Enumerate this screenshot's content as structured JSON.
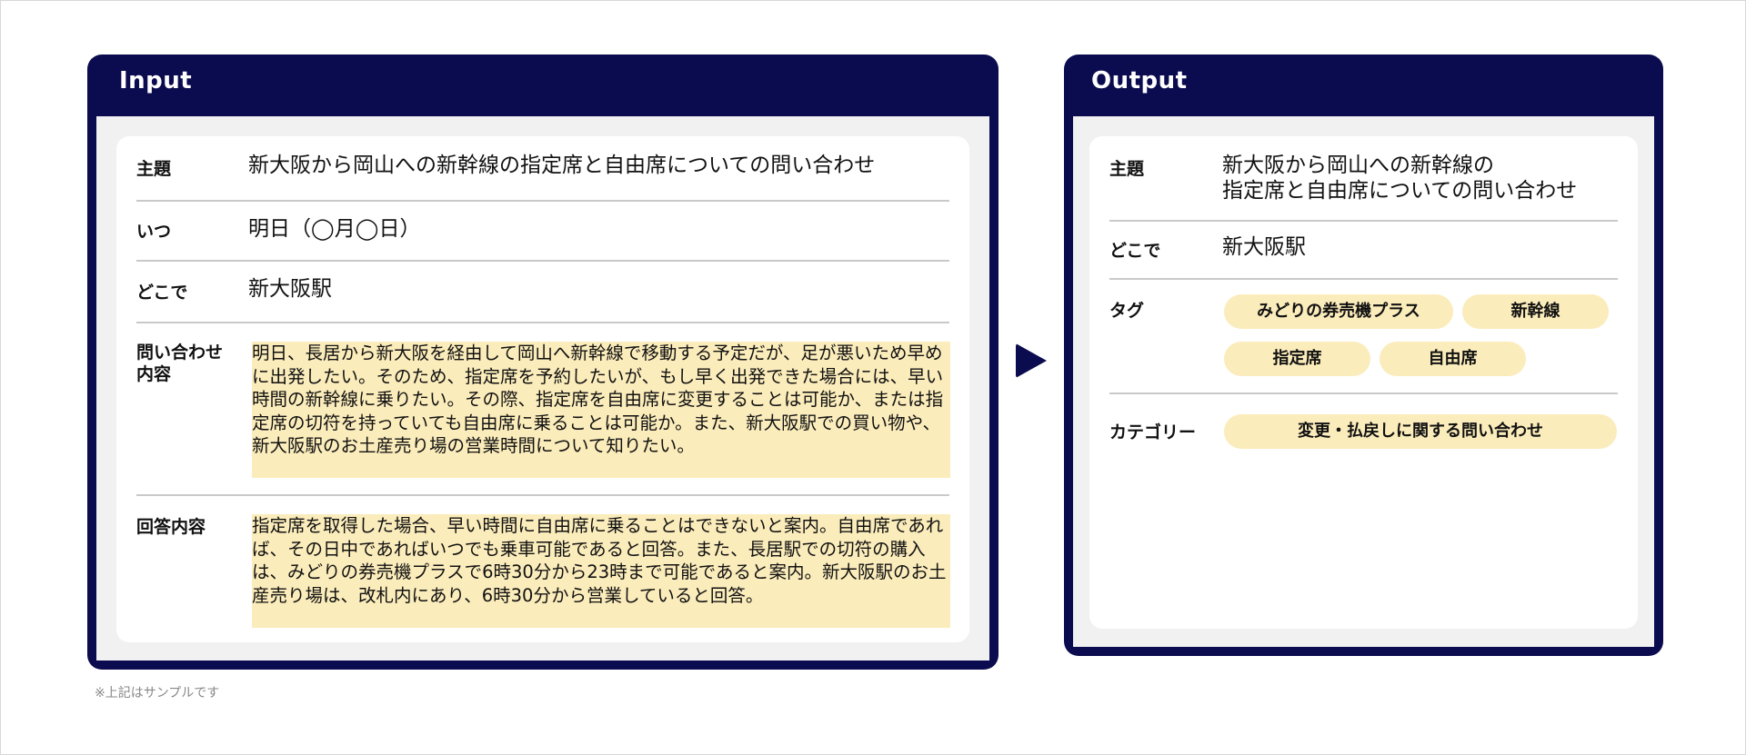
{
  "input_panel": {
    "title": "Input",
    "rows": {
      "subject": {
        "label": "主題",
        "value": "新大阪から岡山への新幹線の指定席と自由席についての問い合わせ"
      },
      "when": {
        "label": "いつ",
        "value": "明日（◯月◯日）"
      },
      "where": {
        "label": "どこで",
        "value": "新大阪駅"
      },
      "inquiry": {
        "label_line1": "問い合わせ",
        "label_line2": "内容",
        "value": "明日、長居から新大阪を経由して岡山へ新幹線で移動する予定だが、足が悪いため早めに出発したい。そのため、指定席を予約したいが、もし早く出発できた場合には、早い時間の新幹線に乗りたい。その際、指定席を自由席に変更することは可能か、または指定席の切符を持っていても自由席に乗ることは可能か。また、新大阪駅での買い物や、新大阪駅のお土産売り場の営業時間について知りたい。"
      },
      "answer": {
        "label": "回答内容",
        "value": "指定席を取得した場合、早い時間に自由席に乗ることはできないと案内。自由席であれば、その日中であればいつでも乗車可能であると回答。また、長居駅での切符の購入は、みどりの券売機プラスで6時30分から23時まで可能であると案内。新大阪駅のお土産売り場は、改札内にあり、6時30分から営業していると回答。"
      }
    }
  },
  "output_panel": {
    "title": "Output",
    "rows": {
      "subject": {
        "label": "主題",
        "value_line1": "新大阪から岡山への新幹線の",
        "value_line2": "指定席と自由席についての問い合わせ"
      },
      "where": {
        "label": "どこで",
        "value": "新大阪駅"
      },
      "tags": {
        "label": "タグ",
        "items": [
          "みどりの券売機プラス",
          "新幹線",
          "指定席",
          "自由席"
        ]
      },
      "category": {
        "label": "カテゴリー",
        "value": "変更・払戻しに関する問い合わせ"
      }
    }
  },
  "footnote": "※上記はサンプルです",
  "colors": {
    "panel": "#0b0b4f",
    "highlight": "#fbecbb",
    "body_bg": "#f1f1f1",
    "divider": "#c9c9c9"
  }
}
